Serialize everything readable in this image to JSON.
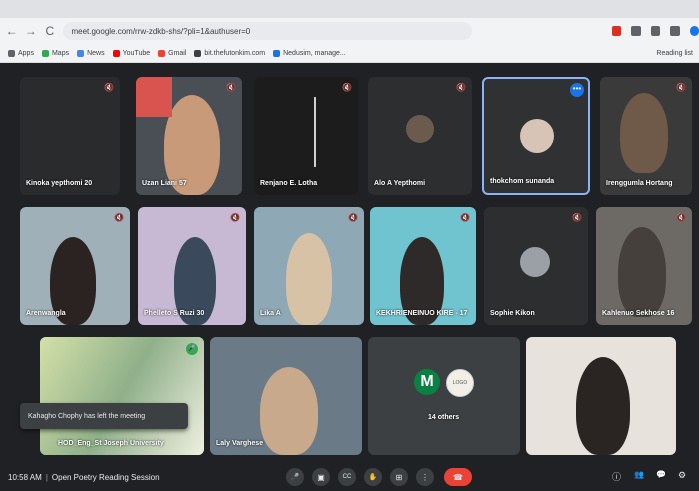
{
  "browser": {
    "url": "meet.google.com/rrw-zdkb-shs/?pli=1&authuser=0",
    "nav_back": "←",
    "nav_forward": "→",
    "nav_reload": "C",
    "bookmarks": [
      {
        "label": "Apps",
        "color": "#5f6368"
      },
      {
        "label": "Maps",
        "color": "#34a853"
      },
      {
        "label": "News",
        "color": "#4285f4"
      },
      {
        "label": "YouTube",
        "color": "#ff0000"
      },
      {
        "label": "Gmail",
        "color": "#ea4335"
      },
      {
        "label": "bit.thefutonkim.com",
        "color": "#3c4043"
      },
      {
        "label": "Nedusim, manage...",
        "color": "#1a73e8"
      }
    ],
    "reading_list": "Reading list"
  },
  "participants": [
    {
      "name": "Kinoka yepthomi 20"
    },
    {
      "name": "Uzan Liani 57"
    },
    {
      "name": "Renjano E. Lotha"
    },
    {
      "name": "Alo A Yepthomi"
    },
    {
      "name": "thokchom sunanda"
    },
    {
      "name": "Irenggumla Hortang"
    },
    {
      "name": "Arenwangla"
    },
    {
      "name": "Phelleto S Ruzi 30"
    },
    {
      "name": "Lika A"
    },
    {
      "name": "KEKHRIENEINUO KIRE - 17"
    },
    {
      "name": "Sophie Kikon"
    },
    {
      "name": "Kahlenuo Sekhose 16"
    },
    {
      "name": "HOD_Eng_St Joseph University"
    },
    {
      "name": "Laly Varghese"
    },
    {
      "name": "14 others"
    },
    {
      "name": ""
    }
  ],
  "others_badge": "M",
  "logo_badge": "LOGO",
  "more_dots": "•••",
  "toast": "Kahagho Chophy has left the meeting",
  "controls": {
    "time": "10:58 AM",
    "separator": "|",
    "meeting_title": "Open Poetry Reading Session"
  },
  "icons": {
    "mic": "🎤",
    "camera": "▣",
    "captions": "CC",
    "hand": "✋",
    "present": "⊞",
    "more": "⋮",
    "end_call": "☎",
    "info": "ⓘ",
    "people": "👥",
    "chat": "💬",
    "activities": "⚙"
  }
}
